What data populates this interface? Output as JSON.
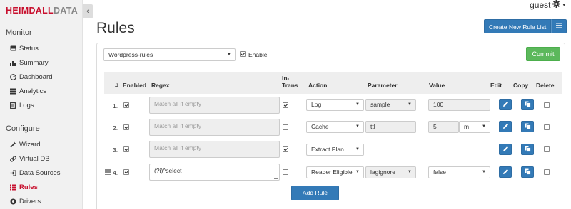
{
  "brand": {
    "logo_a": "HEIMDALL",
    "logo_b": "DATA"
  },
  "sidebar": {
    "collapse": "‹",
    "sections": [
      {
        "title": "Monitor",
        "items": [
          {
            "label": "Status",
            "icon": "hdd-icon"
          },
          {
            "label": "Summary",
            "icon": "bar-chart-icon"
          },
          {
            "label": "Dashboard",
            "icon": "dashboard-icon"
          },
          {
            "label": "Analytics",
            "icon": "analytics-icon"
          },
          {
            "label": "Logs",
            "icon": "document-icon"
          }
        ]
      },
      {
        "title": "Configure",
        "items": [
          {
            "label": "Wizard",
            "icon": "wand-icon"
          },
          {
            "label": "Virtual DB",
            "icon": "link-icon"
          },
          {
            "label": "Data Sources",
            "icon": "login-icon"
          },
          {
            "label": "Rules",
            "icon": "list-icon",
            "active": true
          },
          {
            "label": "Drivers",
            "icon": "driver-icon"
          }
        ]
      }
    ]
  },
  "user": {
    "name": "guest",
    "icon": "gear-icon"
  },
  "page": {
    "title": "Rules"
  },
  "toolbar": {
    "create_label": "Create New Rule List",
    "menu_icon": "hamburger-icon"
  },
  "rule_list": {
    "selected": "Wordpress-rules",
    "enable_label": "Enable",
    "enabled": true,
    "commit_label": "Commit"
  },
  "table": {
    "headers": {
      "num": "#",
      "enabled": "Enabled",
      "regex": "Regex",
      "intrans": "In-Trans",
      "action": "Action",
      "parameter": "Parameter",
      "value": "Value",
      "edit": "Edit",
      "copy": "Copy",
      "delete": "Delete"
    },
    "rows": [
      {
        "num": "1.",
        "enabled": true,
        "regex": "",
        "regex_placeholder": "Match all if empty",
        "intrans": true,
        "action": "Log",
        "parameter": "sample",
        "parameter_type": "select",
        "value": "100",
        "value_unit": "",
        "delete": false
      },
      {
        "num": "2.",
        "enabled": true,
        "regex": "",
        "regex_placeholder": "Match all if empty",
        "intrans": false,
        "action": "Cache",
        "parameter": "ttl",
        "parameter_type": "input",
        "value": "5",
        "value_unit": "m",
        "delete": false
      },
      {
        "num": "3.",
        "enabled": true,
        "regex": "",
        "regex_placeholder": "Match all if empty",
        "intrans": true,
        "action": "Extract Plan",
        "parameter": "",
        "parameter_type": "none",
        "value": "",
        "value_unit": "",
        "delete": false
      },
      {
        "num": "4.",
        "enabled": true,
        "regex": "(?i)^select",
        "regex_placeholder": "",
        "intrans": false,
        "action": "Reader Eligible",
        "parameter": "lagignore",
        "parameter_type": "select",
        "value": "false",
        "value_unit": "",
        "value_type": "select",
        "delete": false
      }
    ]
  },
  "add_rule_label": "Add Rule",
  "colors": {
    "brand_red": "#c8102e",
    "primary": "#337ab7",
    "success": "#5cb85c"
  }
}
